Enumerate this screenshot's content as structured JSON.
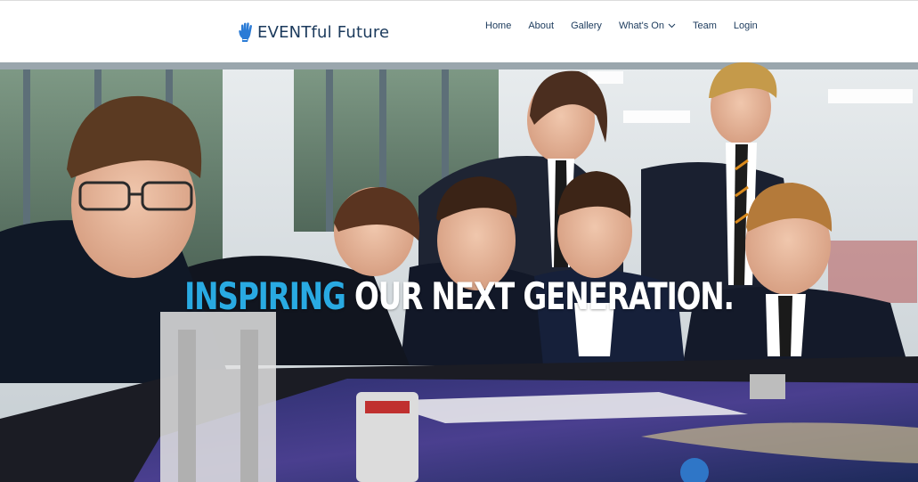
{
  "brand": {
    "name": "EVENTful Future",
    "icon": "hand-icon",
    "color": "#1b3a5c",
    "icon_color": "#2a7bd6"
  },
  "nav": {
    "items": [
      {
        "label": "Home"
      },
      {
        "label": "About"
      },
      {
        "label": "Gallery"
      },
      {
        "label": "What's On",
        "has_dropdown": true
      },
      {
        "label": "Team"
      },
      {
        "label": "Login"
      }
    ]
  },
  "hero": {
    "heading_accent": "INSPIRING",
    "heading_rest": " OUR NEXT GENERATION.",
    "accent_color": "#29aae2",
    "image_description": "photo-icon"
  }
}
